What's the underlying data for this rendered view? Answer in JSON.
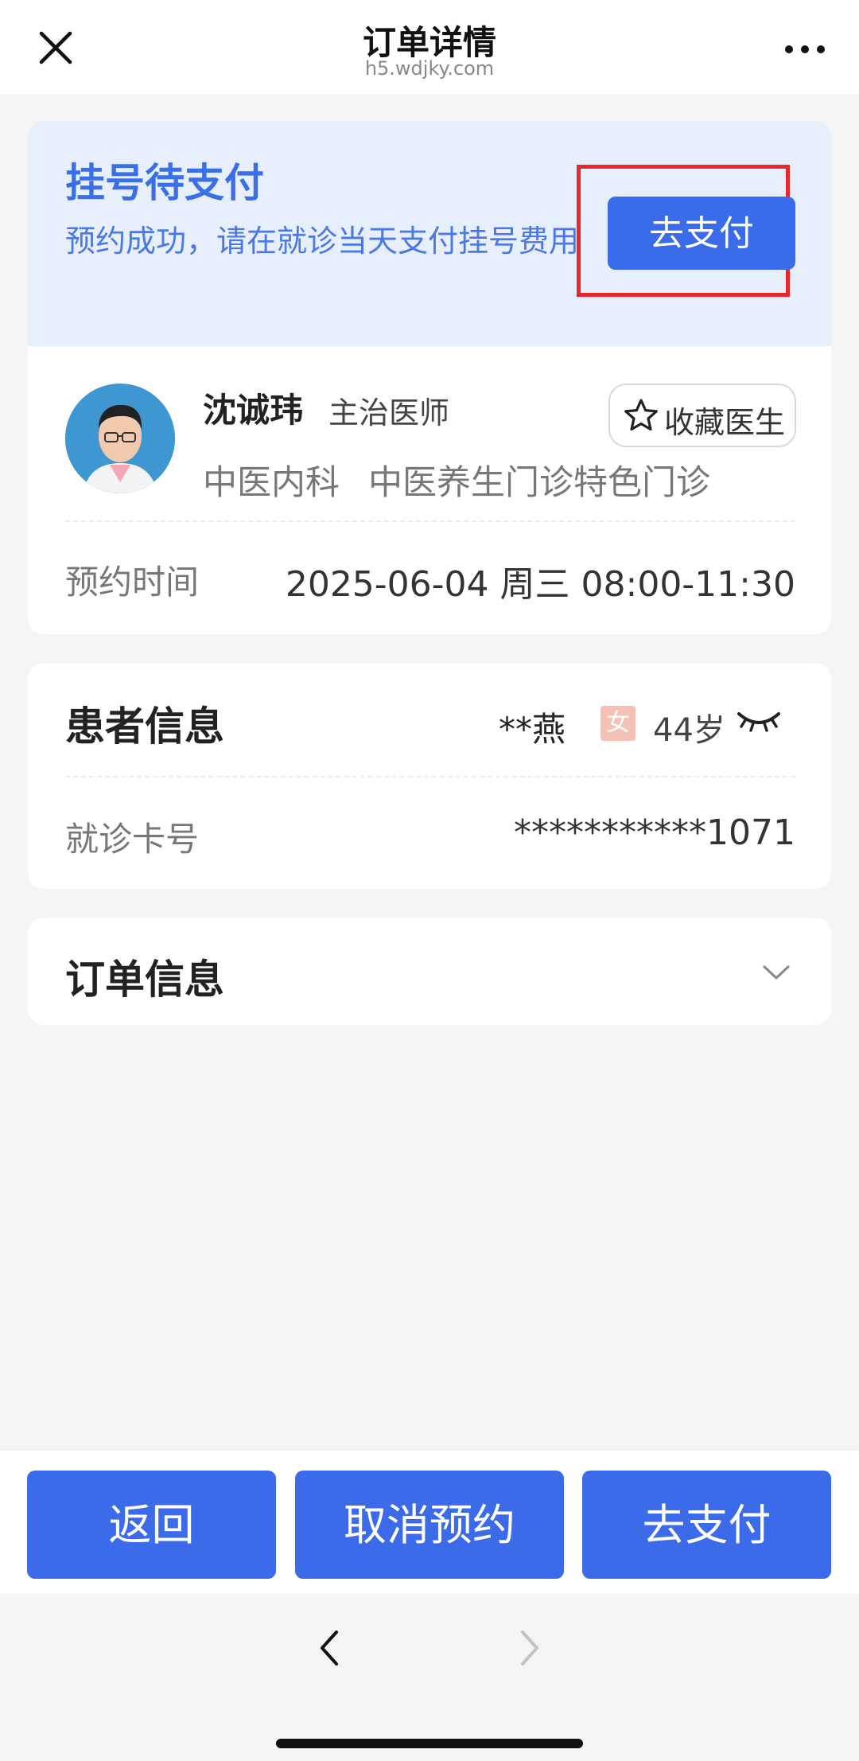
{
  "nav": {
    "title": "订单详情",
    "subtitle": "h5.wdjky.com"
  },
  "status": {
    "title": "挂号待支付",
    "description": "预约成功，请在就诊当天支付挂号费用",
    "pay_label": "去支付"
  },
  "doctor": {
    "name": "沈诚玮",
    "title": "主治医师",
    "favorite_label": "收藏医生",
    "department": "中医内科",
    "clinic": "中医养生门诊特色门诊"
  },
  "appointment": {
    "label": "预约时间",
    "value": "2025-06-04 周三 08:00-11:30"
  },
  "patient": {
    "section_title": "患者信息",
    "name": "**燕",
    "sex": "女",
    "age": "44岁",
    "card_label": "就诊卡号",
    "card_value": "***********1071"
  },
  "order": {
    "section_title": "订单信息"
  },
  "footer": {
    "back_label": "返回",
    "cancel_label": "取消预约",
    "pay_label": "去支付"
  },
  "colors": {
    "accent": "#3b6be9",
    "status_bg": "#e7effc",
    "highlight": "#e8262e"
  }
}
